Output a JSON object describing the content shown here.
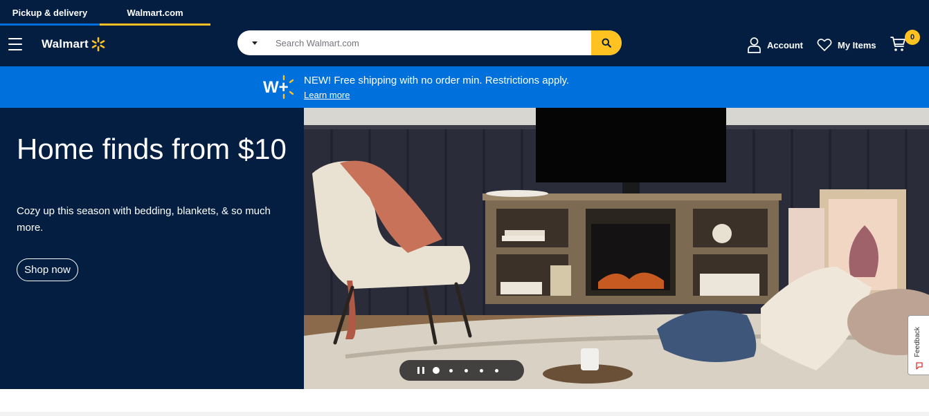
{
  "tabs": [
    {
      "label": "Pickup & delivery"
    },
    {
      "label": "Walmart.com"
    }
  ],
  "header": {
    "logo_text": "Walmart",
    "search_placeholder": "Search Walmart.com",
    "account_label": "Account",
    "my_items_label": "My Items",
    "cart_count": "0"
  },
  "promo": {
    "logo_text": "W+",
    "message": "NEW! Free shipping with no order min. Restrictions apply.",
    "link": "Learn more"
  },
  "hero": {
    "title": "Home finds from $10",
    "subtitle": "Cozy up this season with bedding, blankets, & so much more.",
    "cta": "Shop now",
    "carousel_slides": 5,
    "active_slide": 1
  },
  "feedback_label": "Feedback",
  "colors": {
    "navy": "#041e42",
    "blue": "#0071dc",
    "yellow": "#ffc220"
  }
}
